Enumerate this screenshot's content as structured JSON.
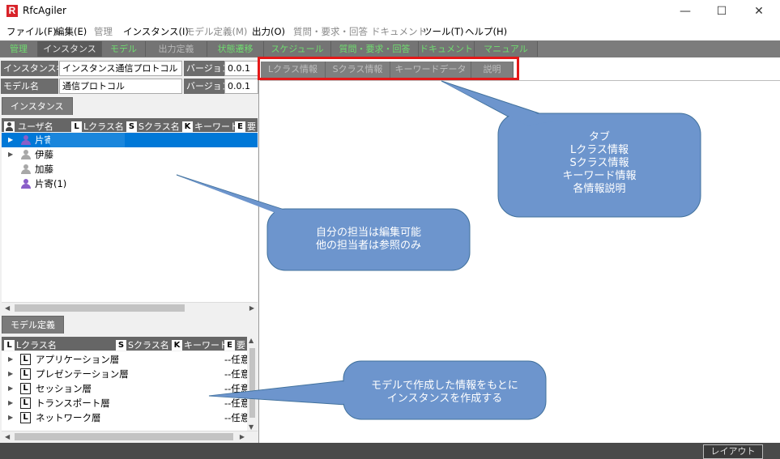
{
  "app": {
    "logo": "R",
    "title": "RfcAgiler"
  },
  "window": {
    "minimize": "—",
    "maximize": "☐",
    "close": "✕"
  },
  "menu": [
    {
      "label": "ファイル(F)",
      "enabled": true
    },
    {
      "label": "編集(E)",
      "enabled": true
    },
    {
      "label": "管理",
      "enabled": false
    },
    {
      "label": "インスタンス(I)",
      "enabled": true
    },
    {
      "label": "モデル定義(M)",
      "enabled": false
    },
    {
      "label": "出力(O)",
      "enabled": true
    },
    {
      "label": "質問・要求・回答",
      "enabled": false
    },
    {
      "label": "ドキュメント",
      "enabled": false
    },
    {
      "label": "ツール(T)",
      "enabled": true
    },
    {
      "label": "ヘルプ(H)",
      "enabled": true
    }
  ],
  "modules": [
    "管理",
    "インスタンス",
    "モデル",
    "出力定義",
    "状態遷移",
    "スケジュール",
    "質問・要求・回答",
    "ドキュメント",
    "マニュアル"
  ],
  "instance_panel": {
    "instance_name_label": "インスタンス名",
    "instance_name_value": "インスタンス通信プロトコル",
    "version_label": "バージョン",
    "version_value": "0.0.1",
    "model_name_label": "モデル名",
    "model_name_value": "通信プロトコル",
    "model_version_label": "バージョン",
    "model_version_value": "0.0.1",
    "tab": "インスタンス",
    "columns": {
      "icon_u": "👤",
      "user": "ユーザ名",
      "icon_l": "L",
      "lclass": "Lクラス名",
      "icon_s": "S",
      "sclass": "Sクラス名",
      "icon_k": "K",
      "keyword": "キーワード",
      "icon_e": "E",
      "req": "要"
    },
    "users": [
      {
        "name": "片寄",
        "expandable": true,
        "editable": true,
        "selected": true
      },
      {
        "name": "伊藤",
        "expandable": true,
        "editable": false,
        "selected": false
      },
      {
        "name": "加藤",
        "expandable": false,
        "editable": false,
        "selected": false
      },
      {
        "name": "片寄(1)",
        "expandable": false,
        "editable": true,
        "selected": false
      }
    ]
  },
  "model_panel": {
    "tab": "モデル定義",
    "columns": {
      "icon_l": "L",
      "lclass": "Lクラス名",
      "icon_s": "S",
      "sclass": "Sクラス名",
      "icon_k": "K",
      "keyword": "キーワード",
      "icon_e": "E",
      "req": "要"
    },
    "items": [
      {
        "icon": "L",
        "name": "アプリケーション層",
        "value": "--任意"
      },
      {
        "icon": "L",
        "name": "プレゼンテーション層",
        "value": "--任意"
      },
      {
        "icon": "L",
        "name": "セッション層",
        "value": "--任意"
      },
      {
        "icon": "L",
        "name": "トランスポート層",
        "value": "--任意"
      },
      {
        "icon": "L",
        "name": "ネットワーク層",
        "value": "--任意"
      }
    ]
  },
  "right_tabs": [
    "Lクラス情報",
    "Sクラス情報",
    "キーワードデータ",
    "説明"
  ],
  "callouts": {
    "tabs": [
      "タブ",
      "Lクラス情報",
      "Sクラス情報",
      "キーワード情報",
      "各情報説明"
    ],
    "edit": [
      "自分の担当は編集可能",
      "他の担当者は参照のみ"
    ],
    "model": [
      "モデルで作成した情報をもとに",
      "インスタンスを作成する"
    ]
  },
  "status": {
    "layout_button": "レイアウト"
  },
  "colors": {
    "callout_fill": "#6d95cd",
    "callout_stroke": "#41719c",
    "highlight": "#e41818",
    "selection": "#0078d7",
    "module_text": "#6fdc6f"
  }
}
